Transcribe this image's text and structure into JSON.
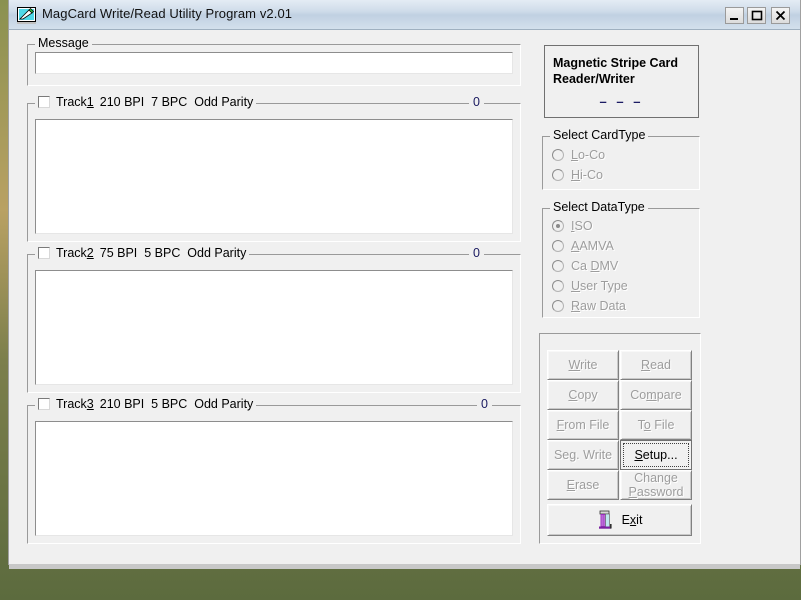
{
  "window": {
    "title": "MagCard Write/Read Utility Program v2.01",
    "app_icon": "magcard-pen-icon",
    "controls": {
      "minimize": "minimize-icon",
      "maximize": "maximize-icon",
      "close": "close-icon"
    }
  },
  "message": {
    "legend": "Message",
    "value": "",
    "placeholder": ""
  },
  "tracks": [
    {
      "id": "track1",
      "checkbox_checked": false,
      "label": "Track1",
      "label_accel": "1",
      "spec": "210 BPI  7 BPC  Odd Parity",
      "count": "0",
      "value": ""
    },
    {
      "id": "track2",
      "checkbox_checked": false,
      "label": "Track2",
      "label_accel": "2",
      "spec": "75 BPI  5 BPC  Odd Parity",
      "count": "0",
      "value": ""
    },
    {
      "id": "track3",
      "checkbox_checked": false,
      "label": "Track3",
      "label_accel": "3",
      "spec": "210 BPI  5 BPC  Odd Parity",
      "count": "0",
      "value": ""
    }
  ],
  "reader": {
    "title_line1": "Magnetic Stripe Card",
    "title_line2": "Reader/Writer",
    "status": "– – –",
    "status_color": "#1c1c64"
  },
  "card_type": {
    "legend": "Select CardType",
    "options": [
      {
        "label": "Lo-Co",
        "accel": "L",
        "rest": "o-Co",
        "selected": false,
        "enabled": false
      },
      {
        "label": "Hi-Co",
        "accel": "H",
        "rest": "i-Co",
        "selected": false,
        "enabled": false
      }
    ]
  },
  "data_type": {
    "legend": "Select DataType",
    "options": [
      {
        "label": "ISO",
        "pre": "",
        "accel": "I",
        "rest": "SO",
        "selected": true,
        "enabled": false
      },
      {
        "label": "AAMVA",
        "pre": "",
        "accel": "A",
        "rest": "AMVA",
        "selected": false,
        "enabled": false
      },
      {
        "label": "Ca DMV",
        "pre": "Ca ",
        "accel": "D",
        "rest": "MV",
        "selected": false,
        "enabled": false
      },
      {
        "label": "User Type",
        "pre": "",
        "accel": "U",
        "rest": "ser Type",
        "selected": false,
        "enabled": false
      },
      {
        "label": "Raw Data",
        "pre": "",
        "accel": "R",
        "rest": "aw Data",
        "selected": false,
        "enabled": false
      }
    ]
  },
  "buttons": [
    {
      "id": "write",
      "pre": "",
      "accel": "W",
      "rest": "rite",
      "label": "Write",
      "enabled": false,
      "focused": false
    },
    {
      "id": "read",
      "pre": "",
      "accel": "R",
      "rest": "ead",
      "label": "Read",
      "enabled": false,
      "focused": false
    },
    {
      "id": "copy",
      "pre": "",
      "accel": "C",
      "rest": "opy",
      "label": "Copy",
      "enabled": false,
      "focused": false
    },
    {
      "id": "compare",
      "pre": "Co",
      "accel": "m",
      "rest": "pare",
      "label": "Compare",
      "enabled": false,
      "focused": false
    },
    {
      "id": "from-file",
      "pre": "",
      "accel": "F",
      "rest": "rom File",
      "label": "From File",
      "enabled": false,
      "focused": false
    },
    {
      "id": "to-file",
      "pre": "T",
      "accel": "o",
      "rest": " File",
      "label": "To File",
      "enabled": false,
      "focused": false
    },
    {
      "id": "seg-write",
      "pre": "",
      "accel": "",
      "rest": "Seg. Write",
      "label": "Seg. Write",
      "enabled": false,
      "focused": false
    },
    {
      "id": "setup",
      "pre": "",
      "accel": "S",
      "rest": "etup...",
      "label": "Setup...",
      "enabled": true,
      "focused": true
    },
    {
      "id": "erase",
      "pre": "",
      "accel": "E",
      "rest": "rase",
      "label": "Erase",
      "enabled": false,
      "focused": false
    },
    {
      "id": "change-password",
      "pre": "",
      "accel": "P",
      "rest": "assword",
      "label": "Change Password",
      "line1": "Change",
      "enabled": false,
      "focused": false
    }
  ],
  "exit_button": {
    "pre": "E",
    "accel": "x",
    "rest": "it",
    "label": "Exit",
    "icon": "exit-door-icon",
    "enabled": true
  }
}
